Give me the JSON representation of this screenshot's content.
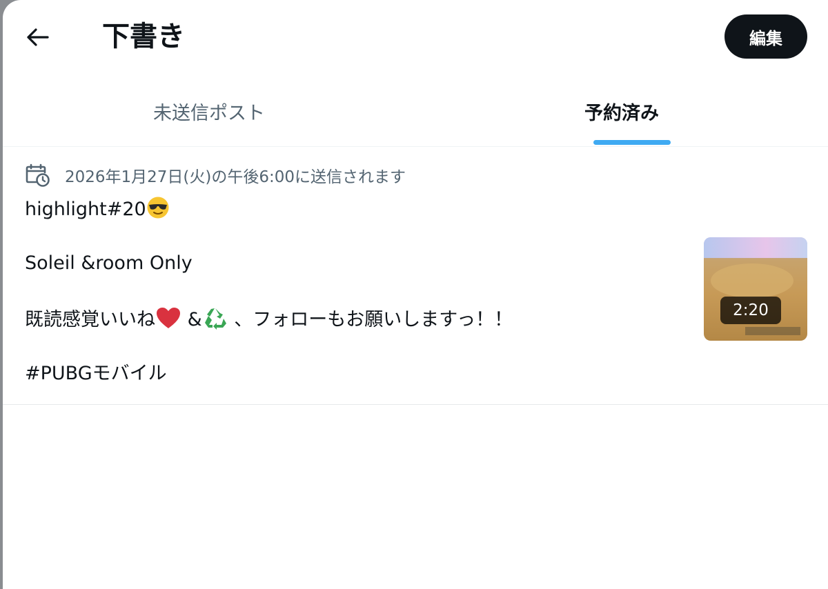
{
  "header": {
    "title": "下書き",
    "edit_label": "編集"
  },
  "tabs": [
    {
      "label": "未送信ポスト",
      "active": false
    },
    {
      "label": "予約済み",
      "active": true
    }
  ],
  "draft": {
    "schedule_text": "2026年1月27日(火)の午後6:00に送信されます",
    "lines": {
      "l1_text": "highlight#20",
      "l2_text": "Soleil &room Only",
      "l3_part1": "既読感覚いいね",
      "l3_part2": " &",
      "l3_part3": " 、フォローもお願いしますっ！！",
      "l4_text": "#PUBGモバイル"
    },
    "emojis": [
      "smiling-face-with-sunglasses",
      "red-heart",
      "recycling-symbol"
    ],
    "media": {
      "duration": "2:20"
    }
  },
  "colors": {
    "accent": "#1d9bf0",
    "text_primary": "#0f1419",
    "text_secondary": "#536471",
    "button_bg": "#0f1419"
  }
}
